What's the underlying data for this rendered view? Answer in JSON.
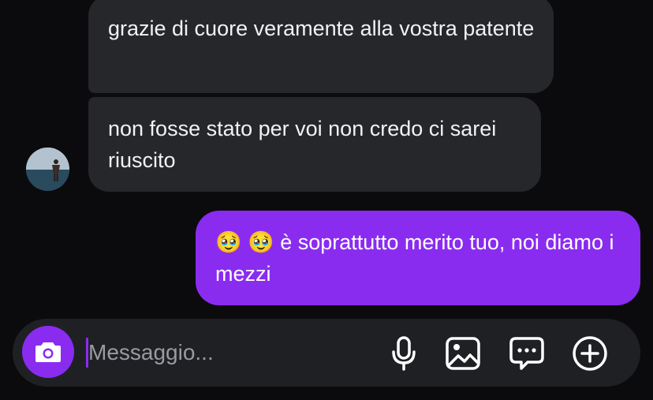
{
  "theme": {
    "background": "#0b0b0d",
    "incoming_bubble": "#26272b",
    "outgoing_bubble": "#8a2cf0",
    "composer_background": "#1f2024",
    "accent": "#8a2cf0"
  },
  "messages": [
    {
      "direction": "incoming",
      "text": "grazie di cuore veramente alla vostra patente"
    },
    {
      "direction": "incoming",
      "text": "non fosse stato per voi non credo ci sarei riuscito"
    },
    {
      "direction": "outgoing",
      "text": "🥹 🥹  è soprattutto merito tuo, noi diamo i mezzi"
    }
  ],
  "composer": {
    "placeholder": "Messaggio...",
    "value": "",
    "icons": {
      "camera": "camera-icon",
      "mic": "microphone-icon",
      "gallery": "image-icon",
      "sticker": "chat-bubble-icon",
      "plus": "plus-circle-icon"
    }
  }
}
